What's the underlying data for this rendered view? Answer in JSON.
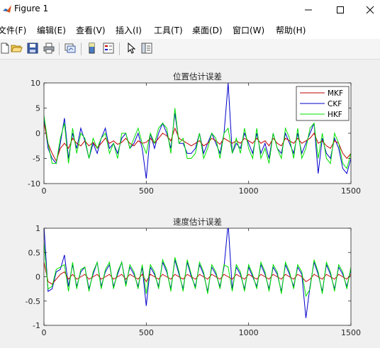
{
  "window": {
    "title": "Figure 1",
    "minimize_icon": "minimize-icon",
    "maximize_icon": "maximize-icon",
    "close_icon": "close-icon"
  },
  "menu": [
    {
      "label": "文件(F)"
    },
    {
      "label": "编辑(E)"
    },
    {
      "label": "查看(V)"
    },
    {
      "label": "插入(I)"
    },
    {
      "label": "工具(T)"
    },
    {
      "label": "桌面(D)"
    },
    {
      "label": "窗口(W)"
    },
    {
      "label": "帮助(H)"
    }
  ],
  "toolbar": [
    {
      "icon": "new-figure-icon"
    },
    {
      "icon": "open-file-icon"
    },
    {
      "icon": "save-icon"
    },
    {
      "icon": "print-icon"
    },
    {
      "icon": "link-plot-icon"
    },
    {
      "icon": "insert-colorbar-icon"
    },
    {
      "icon": "insert-legend-icon"
    },
    {
      "icon": "edit-plot-arrow-icon"
    },
    {
      "icon": "property-inspector-icon"
    }
  ],
  "colors": {
    "MKF": "#c00000",
    "CKF": "#0000cc",
    "HKF": "#00e000"
  },
  "chart_data": [
    {
      "type": "line",
      "title": "位置估计误差",
      "xlabel": "",
      "ylabel": "",
      "xlim": [
        0,
        1500
      ],
      "ylim": [
        -10,
        10
      ],
      "xticks": [
        0,
        500,
        1000,
        1500
      ],
      "yticks": [
        -10,
        -5,
        0,
        5,
        10
      ],
      "grid": false,
      "legend": "top-right",
      "series": [
        {
          "name": "MKF",
          "x": [
            0,
            20,
            40,
            60,
            80,
            100,
            120,
            140,
            160,
            180,
            200,
            220,
            240,
            260,
            280,
            300,
            320,
            340,
            360,
            380,
            400,
            420,
            440,
            460,
            480,
            500,
            520,
            540,
            560,
            580,
            600,
            620,
            640,
            660,
            680,
            700,
            720,
            740,
            760,
            780,
            800,
            820,
            840,
            860,
            880,
            900,
            920,
            940,
            960,
            980,
            1000,
            1020,
            1040,
            1060,
            1080,
            1100,
            1120,
            1140,
            1160,
            1180,
            1200,
            1220,
            1240,
            1260,
            1280,
            1300,
            1320,
            1340,
            1360,
            1380,
            1400,
            1420,
            1440,
            1460,
            1480,
            1500
          ],
          "values": [
            2,
            -2,
            -4,
            -5.5,
            -3,
            -2,
            -3,
            -1,
            -2,
            -2.5,
            -1.5,
            -2.5,
            -1.8,
            -3,
            -2,
            -1,
            -2,
            -1.5,
            -2.2,
            -1.8,
            -1,
            -2,
            -2.5,
            -1.5,
            -2,
            -1.8,
            -1,
            -2,
            -1,
            0,
            -0.5,
            -1.5,
            1,
            -1,
            -1.5,
            -2,
            -2.5,
            -2,
            -1.5,
            -2.5,
            -2,
            -1,
            -1.5,
            -2.2,
            -1,
            -1.5,
            -2,
            -1.5,
            -2,
            -1,
            -1.5,
            -2,
            -1,
            -2,
            -1.5,
            -2.5,
            -1,
            -2,
            -2.5,
            -1,
            -1.5,
            -2,
            -1,
            -2,
            -1.5,
            -1,
            0,
            -2,
            -1.5,
            -2.5,
            -3,
            -1.5,
            -2,
            -4,
            -5,
            -4
          ]
        },
        {
          "name": "CKF",
          "x": [
            0,
            20,
            40,
            60,
            80,
            100,
            120,
            140,
            160,
            180,
            200,
            220,
            240,
            260,
            280,
            300,
            320,
            340,
            360,
            380,
            400,
            420,
            440,
            460,
            480,
            500,
            520,
            540,
            560,
            580,
            600,
            620,
            640,
            660,
            680,
            700,
            720,
            740,
            760,
            780,
            800,
            820,
            840,
            860,
            880,
            900,
            920,
            940,
            960,
            980,
            1000,
            1020,
            1040,
            1060,
            1080,
            1100,
            1120,
            1140,
            1160,
            1180,
            1200,
            1220,
            1240,
            1260,
            1280,
            1300,
            1320,
            1340,
            1360,
            1380,
            1400,
            1420,
            1440,
            1460,
            1480,
            1500
          ],
          "values": [
            3,
            -3,
            -5,
            -6,
            -2,
            3,
            -5,
            0,
            -3,
            1,
            -1.5,
            -5,
            -2,
            -4,
            -1,
            1,
            -3,
            -2,
            -4,
            -1,
            0,
            -3,
            -2,
            0,
            -3,
            -9,
            0,
            -3,
            0,
            2,
            0,
            -3,
            4,
            -2,
            -2,
            -4,
            -4,
            -3,
            0,
            -4,
            -2,
            0,
            -2,
            -4,
            0,
            10,
            -4,
            -2,
            -3,
            0,
            -2,
            -4,
            0,
            -4,
            -2,
            -5,
            0,
            -3,
            -4,
            0,
            -2,
            -4,
            0,
            -4,
            -2,
            0,
            2,
            -8,
            -1,
            -4,
            -5,
            -1,
            -3,
            -7,
            -8,
            -5
          ]
        },
        {
          "name": "HKF",
          "x": [
            0,
            20,
            40,
            60,
            80,
            100,
            120,
            140,
            160,
            180,
            200,
            220,
            240,
            260,
            280,
            300,
            320,
            340,
            360,
            380,
            400,
            420,
            440,
            460,
            480,
            500,
            520,
            540,
            560,
            580,
            600,
            620,
            640,
            660,
            680,
            700,
            720,
            740,
            760,
            780,
            800,
            820,
            840,
            860,
            880,
            900,
            920,
            940,
            960,
            980,
            1000,
            1020,
            1040,
            1060,
            1080,
            1100,
            1120,
            1140,
            1160,
            1180,
            1200,
            1220,
            1240,
            1260,
            1280,
            1300,
            1320,
            1340,
            1360,
            1380,
            1400,
            1420,
            1440,
            1460,
            1480,
            1500
          ],
          "values": [
            3.5,
            -2,
            -6,
            -6,
            -1,
            2,
            -6,
            1,
            -4,
            0,
            -1,
            -5,
            -1,
            -3,
            -1,
            0,
            -4,
            -2,
            -5,
            0,
            0,
            -3,
            -1,
            1,
            -2,
            -4,
            0,
            -2,
            1,
            2,
            1,
            -4,
            5,
            -2,
            -1,
            -5,
            -5,
            -4,
            0,
            -5,
            -3,
            0,
            -1,
            -5,
            0,
            1,
            -4,
            -1,
            -4,
            1,
            -3,
            -5,
            1,
            -5,
            -3,
            -6,
            0,
            -3,
            -5,
            1,
            -1,
            -5,
            1,
            -5,
            -3,
            1,
            2,
            -5,
            0,
            -5,
            -6,
            0,
            -2,
            -6,
            -7,
            -4
          ]
        }
      ]
    },
    {
      "type": "line",
      "title": "速度估计误差",
      "xlabel": "",
      "ylabel": "",
      "xlim": [
        0,
        1500
      ],
      "ylim": [
        -1,
        1
      ],
      "xticks": [
        0,
        500,
        1000,
        1500
      ],
      "yticks": [
        -1,
        -0.5,
        0,
        0.5,
        1
      ],
      "grid": false,
      "legend": "none",
      "series": [
        {
          "name": "MKF",
          "x": [
            0,
            20,
            40,
            60,
            80,
            100,
            120,
            140,
            160,
            180,
            200,
            220,
            240,
            260,
            280,
            300,
            320,
            340,
            360,
            380,
            400,
            420,
            440,
            460,
            480,
            500,
            520,
            540,
            560,
            580,
            600,
            620,
            640,
            660,
            680,
            700,
            720,
            740,
            760,
            780,
            800,
            820,
            840,
            860,
            880,
            900,
            920,
            940,
            960,
            980,
            1000,
            1020,
            1040,
            1060,
            1080,
            1100,
            1120,
            1140,
            1160,
            1180,
            1200,
            1220,
            1240,
            1260,
            1280,
            1300,
            1320,
            1340,
            1360,
            1380,
            1400,
            1420,
            1440,
            1460,
            1480,
            1500
          ],
          "values": [
            0.3,
            -0.1,
            -0.15,
            -0.05,
            0.05,
            0.1,
            -0.05,
            0.05,
            -0.05,
            0,
            0.05,
            -0.05,
            0,
            0.05,
            -0.05,
            0,
            0.05,
            -0.05,
            0,
            0.05,
            -0.05,
            0.05,
            0,
            -0.05,
            0.05,
            -0.1,
            0.05,
            0,
            -0.05,
            0.05,
            0,
            -0.05,
            0.05,
            0,
            -0.05,
            0.05,
            0,
            -0.05,
            0.05,
            0,
            -0.05,
            0.05,
            0,
            -0.05,
            0.05,
            0,
            -0.05,
            0.05,
            0,
            -0.05,
            0.05,
            0,
            -0.05,
            0.05,
            0,
            -0.05,
            0.05,
            0,
            -0.05,
            0.05,
            0,
            -0.05,
            0.05,
            0,
            -0.1,
            -0.05,
            0.05,
            0,
            -0.05,
            0.05,
            0,
            -0.05,
            0.05,
            0,
            -0.05,
            0.05
          ]
        },
        {
          "name": "CKF",
          "x": [
            0,
            20,
            40,
            60,
            80,
            100,
            120,
            140,
            160,
            180,
            200,
            220,
            240,
            260,
            280,
            300,
            320,
            340,
            360,
            380,
            400,
            420,
            440,
            460,
            480,
            500,
            520,
            540,
            560,
            580,
            600,
            620,
            640,
            660,
            680,
            700,
            720,
            740,
            760,
            780,
            800,
            820,
            840,
            860,
            880,
            900,
            920,
            940,
            960,
            980,
            1000,
            1020,
            1040,
            1060,
            1080,
            1100,
            1120,
            1140,
            1160,
            1180,
            1200,
            1220,
            1240,
            1260,
            1280,
            1300,
            1320,
            1340,
            1360,
            1380,
            1400,
            1420,
            1440,
            1460,
            1480,
            1500
          ],
          "values": [
            1.05,
            -0.3,
            -0.25,
            0.1,
            0.15,
            0.45,
            -0.2,
            0.25,
            -0.2,
            0.1,
            0.2,
            -0.25,
            0.05,
            0.3,
            -0.2,
            0.1,
            0.25,
            -0.2,
            0.05,
            0.3,
            -0.15,
            0.2,
            0.05,
            -0.2,
            0.2,
            -0.6,
            0.2,
            0.05,
            -0.2,
            0.3,
            0.1,
            -0.25,
            0.35,
            0.05,
            -0.25,
            0.3,
            0,
            -0.2,
            0.25,
            0.05,
            -0.3,
            0.2,
            0.05,
            -0.2,
            0.2,
            1.1,
            -0.25,
            0.2,
            0.05,
            -0.25,
            0.2,
            0,
            -0.2,
            0.25,
            0.05,
            -0.25,
            0.2,
            0.05,
            -0.3,
            0.25,
            0.05,
            -0.2,
            0.2,
            0.05,
            -0.85,
            -0.2,
            0.3,
            0.05,
            -0.3,
            0.25,
            0.05,
            -0.25,
            0.2,
            0.05,
            -0.2,
            0.15
          ]
        },
        {
          "name": "HKF",
          "x": [
            0,
            20,
            40,
            60,
            80,
            100,
            120,
            140,
            160,
            180,
            200,
            220,
            240,
            260,
            280,
            300,
            320,
            340,
            360,
            380,
            400,
            420,
            440,
            460,
            480,
            500,
            520,
            540,
            560,
            580,
            600,
            620,
            640,
            660,
            680,
            700,
            720,
            740,
            760,
            780,
            800,
            820,
            840,
            860,
            880,
            900,
            920,
            940,
            960,
            980,
            1000,
            1020,
            1040,
            1060,
            1080,
            1100,
            1120,
            1140,
            1160,
            1180,
            1200,
            1220,
            1240,
            1260,
            1280,
            1300,
            1320,
            1340,
            1360,
            1380,
            1400,
            1420,
            1440,
            1460,
            1480,
            1500
          ],
          "values": [
            0.7,
            -0.25,
            -0.2,
            0.15,
            0.2,
            0.25,
            -0.3,
            0.3,
            -0.25,
            0.15,
            0.2,
            -0.3,
            0.1,
            0.3,
            -0.25,
            0.15,
            0.3,
            -0.25,
            0.1,
            0.3,
            -0.2,
            0.25,
            0.1,
            -0.25,
            0.25,
            -0.35,
            0.25,
            0.1,
            -0.25,
            0.35,
            0.15,
            -0.3,
            0.4,
            0.1,
            -0.3,
            0.35,
            0.05,
            -0.25,
            0.3,
            0.1,
            -0.35,
            0.25,
            0.1,
            -0.25,
            0.25,
            0.2,
            -0.3,
            0.25,
            0.1,
            -0.3,
            0.25,
            0.05,
            -0.25,
            0.3,
            0.1,
            -0.3,
            0.25,
            0.1,
            -0.35,
            0.3,
            0.1,
            -0.25,
            0.25,
            0.1,
            -0.4,
            -0.25,
            0.35,
            0.1,
            -0.35,
            0.3,
            0.1,
            -0.3,
            0.25,
            0.1,
            -0.25,
            0.2
          ]
        }
      ]
    }
  ]
}
